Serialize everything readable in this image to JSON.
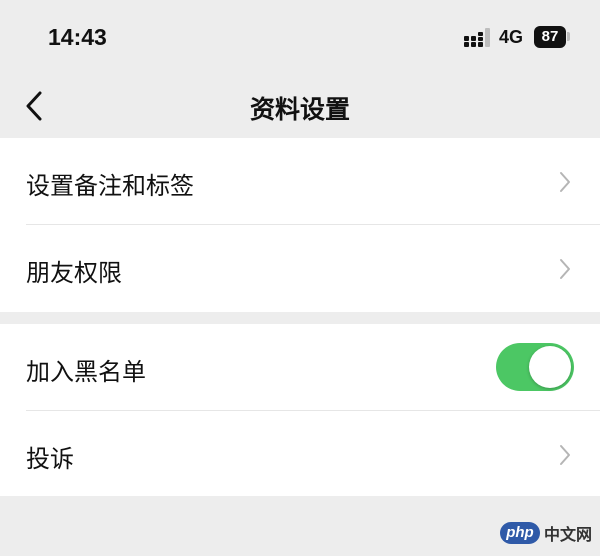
{
  "status_bar": {
    "time": "14:43",
    "network": "4G",
    "battery": "87"
  },
  "nav": {
    "title": "资料设置",
    "back_icon": "chevron-left-icon"
  },
  "groups": [
    {
      "items": [
        {
          "label": "设置备注和标签",
          "control": "chevron"
        },
        {
          "label": "朋友权限",
          "control": "chevron"
        }
      ]
    },
    {
      "items": [
        {
          "label": "加入黑名单",
          "control": "toggle",
          "toggle_on": true
        },
        {
          "label": "投诉",
          "control": "chevron"
        }
      ]
    }
  ],
  "colors": {
    "toggle_on": "#4cc764",
    "background": "#ededed",
    "row_background": "#ffffff"
  },
  "watermark": {
    "badge": "php",
    "text": "中文网"
  }
}
